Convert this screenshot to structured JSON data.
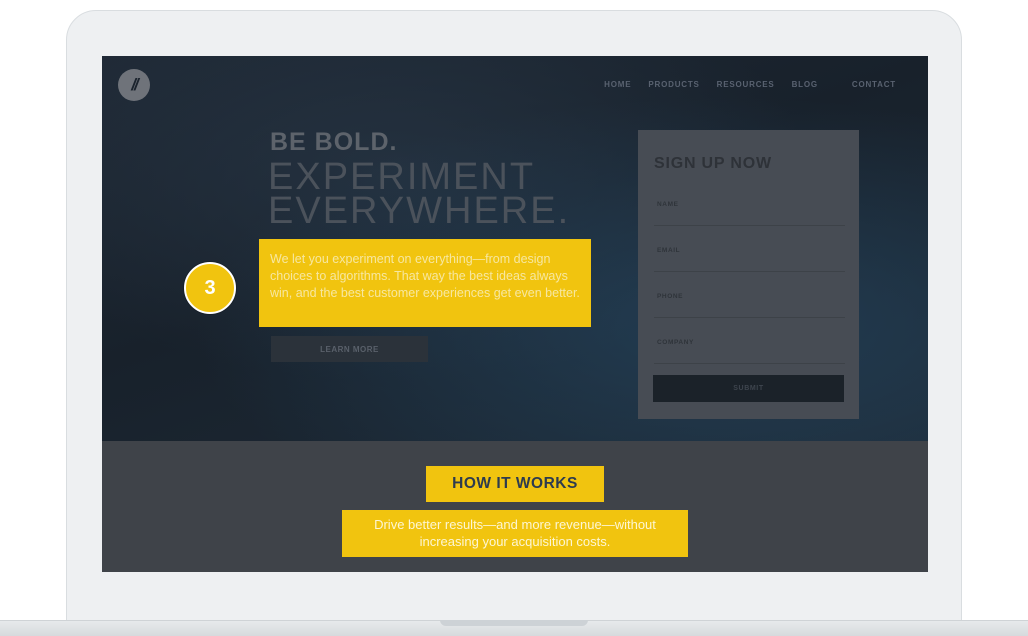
{
  "nav": {
    "items": [
      "HOME",
      "PRODUCTS",
      "RESOURCES",
      "BLOG"
    ],
    "contact": "CONTACT"
  },
  "hero": {
    "headline1": "BE BOLD.",
    "headline2_line1": "EXPERIMENT",
    "headline2_line2": "EVERYWHERE.",
    "intro": "We let you experiment on everything—from design choices to algorithms. That way the best ideas always win, and the best customer experiences get even better.",
    "learn_more": "LEARN MORE",
    "step_number": "3"
  },
  "signup": {
    "title": "SIGN UP NOW",
    "fields": [
      "NAME",
      "EMAIL",
      "PHONE",
      "COMPANY"
    ],
    "submit": "SUBMIT"
  },
  "how_it_works": {
    "title": "HOW IT WORKS",
    "subtitle": "Drive better results—and more revenue—without increasing your acquisition costs."
  },
  "colors": {
    "highlight": "#f1c40f",
    "hero_dark": "#1f2935",
    "section_gray": "#3f4349"
  }
}
